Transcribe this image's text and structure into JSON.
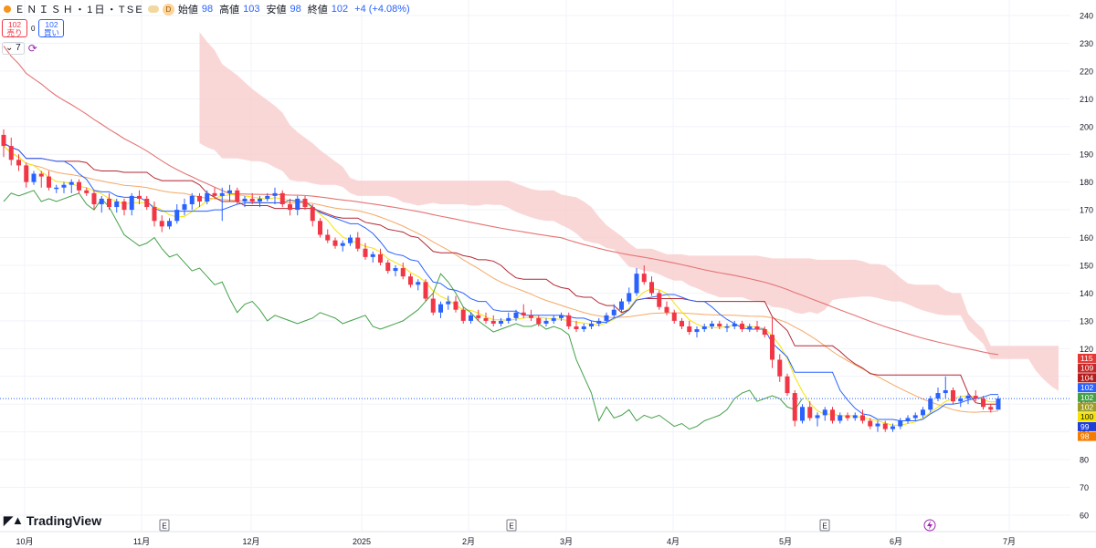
{
  "header": {
    "symbol": "ＥＮＩＳＨ・1日・TSE",
    "badge": "D",
    "open_label": "始値",
    "open_value": "98",
    "high_label": "高値",
    "high_value": "103",
    "low_label": "安値",
    "low_value": "98",
    "close_label": "終値",
    "close_value": "102",
    "change": "+4 (+4.08%)"
  },
  "trade": {
    "sell_price": "102",
    "sell_label": "売り",
    "spread": "0",
    "buy_price": "102",
    "buy_label": "買い"
  },
  "indicator": {
    "period": "7",
    "icon": "refresh-icon"
  },
  "logo": {
    "text": "TradingView",
    "icon": "tradingview-logo-icon"
  },
  "colors": {
    "up": "#2962ff",
    "down": "#f23645",
    "cloud": "#f8c9c9",
    "tenkan": "#2962ff",
    "kijun": "#b22833",
    "chikou": "#43a047",
    "ma_short": "#f5e400",
    "ma_mid": "#f5a865",
    "ma_long": "#e57373"
  },
  "chart_data": {
    "type": "candlestick",
    "y_axis": {
      "min": 60,
      "max": 240,
      "ticks": [
        60,
        70,
        80,
        90,
        100,
        110,
        120,
        130,
        140,
        150,
        160,
        170,
        180,
        190,
        200,
        210,
        220,
        230,
        240
      ]
    },
    "x_axis": {
      "labels": [
        "10月",
        "11月",
        "12月",
        "2025",
        "2月",
        "3月",
        "4月",
        "5月",
        "6月",
        "7月"
      ]
    },
    "earnings_markers": [
      "E",
      "E",
      "E"
    ],
    "price_scale_badges": [
      {
        "value": "115",
        "color": "#e53935"
      },
      {
        "value": "109",
        "color": "#c62828"
      },
      {
        "value": "104",
        "color": "#b71c1c"
      },
      {
        "value": "102",
        "color": "#2962ff"
      },
      {
        "value": "102",
        "color": "#43a047"
      },
      {
        "value": "102",
        "color": "#9e9d24"
      },
      {
        "value": "100",
        "color": "#f5e400"
      },
      {
        "value": "99",
        "color": "#1e3fd8"
      },
      {
        "value": "98",
        "color": "#f57c00"
      }
    ],
    "candles": [
      [
        197,
        199,
        189,
        193
      ],
      [
        193,
        196,
        186,
        188
      ],
      [
        188,
        190,
        184,
        186
      ],
      [
        186,
        187,
        178,
        180
      ],
      [
        180,
        184,
        179,
        183
      ],
      [
        183,
        184,
        178,
        182
      ],
      [
        182,
        184,
        177,
        178
      ],
      [
        178,
        179,
        176,
        178
      ],
      [
        178,
        180,
        176,
        179
      ],
      [
        179,
        181,
        176,
        180
      ],
      [
        180,
        181,
        176,
        177
      ],
      [
        177,
        178,
        175,
        176
      ],
      [
        176,
        177,
        170,
        172
      ],
      [
        172,
        175,
        169,
        174
      ],
      [
        174,
        176,
        170,
        171
      ],
      [
        171,
        174,
        169,
        173
      ],
      [
        173,
        174,
        168,
        170
      ],
      [
        170,
        176,
        168,
        175
      ],
      [
        175,
        177,
        172,
        174
      ],
      [
        174,
        175,
        170,
        171
      ],
      [
        171,
        173,
        164,
        166
      ],
      [
        166,
        168,
        162,
        164
      ],
      [
        164,
        167,
        163,
        166
      ],
      [
        166,
        172,
        165,
        170
      ],
      [
        170,
        174,
        168,
        172
      ],
      [
        172,
        176,
        170,
        175
      ],
      [
        175,
        176,
        171,
        173
      ],
      [
        173,
        177,
        172,
        176
      ],
      [
        176,
        178,
        174,
        175
      ],
      [
        175,
        178,
        166,
        176
      ],
      [
        176,
        179,
        173,
        177
      ],
      [
        177,
        178,
        172,
        173
      ],
      [
        173,
        175,
        171,
        174
      ],
      [
        174,
        176,
        172,
        173
      ],
      [
        173,
        175,
        171,
        174
      ],
      [
        174,
        176,
        173,
        175
      ],
      [
        175,
        178,
        172,
        176
      ],
      [
        176,
        177,
        171,
        172
      ],
      [
        172,
        174,
        168,
        170
      ],
      [
        170,
        175,
        168,
        174
      ],
      [
        174,
        175,
        170,
        171
      ],
      [
        171,
        172,
        164,
        166
      ],
      [
        166,
        167,
        160,
        161
      ],
      [
        161,
        163,
        158,
        159
      ],
      [
        159,
        160,
        156,
        157
      ],
      [
        157,
        159,
        155,
        158
      ],
      [
        158,
        161,
        157,
        160
      ],
      [
        160,
        162,
        155,
        156
      ],
      [
        156,
        158,
        152,
        153
      ],
      [
        153,
        155,
        151,
        154
      ],
      [
        154,
        156,
        150,
        151
      ],
      [
        151,
        152,
        147,
        148
      ],
      [
        148,
        150,
        146,
        149
      ],
      [
        149,
        151,
        145,
        146
      ],
      [
        146,
        147,
        142,
        143
      ],
      [
        143,
        145,
        141,
        144
      ],
      [
        144,
        145,
        137,
        138
      ],
      [
        138,
        140,
        132,
        133
      ],
      [
        133,
        137,
        131,
        136
      ],
      [
        136,
        139,
        134,
        137
      ],
      [
        137,
        139,
        133,
        134
      ],
      [
        134,
        135,
        129,
        130
      ],
      [
        130,
        133,
        129,
        132
      ],
      [
        132,
        134,
        130,
        131
      ],
      [
        131,
        133,
        129,
        130
      ],
      [
        130,
        132,
        128,
        129
      ],
      [
        129,
        131,
        128,
        130
      ],
      [
        130,
        133,
        129,
        131
      ],
      [
        131,
        134,
        130,
        133
      ],
      [
        133,
        136,
        131,
        132
      ],
      [
        132,
        134,
        130,
        131
      ],
      [
        131,
        132,
        128,
        129
      ],
      [
        129,
        131,
        128,
        130
      ],
      [
        130,
        132,
        129,
        131
      ],
      [
        131,
        133,
        130,
        132
      ],
      [
        132,
        133,
        127,
        128
      ],
      [
        128,
        130,
        126,
        127
      ],
      [
        127,
        129,
        126,
        128
      ],
      [
        128,
        130,
        127,
        129
      ],
      [
        129,
        131,
        128,
        130
      ],
      [
        130,
        133,
        129,
        132
      ],
      [
        132,
        136,
        131,
        134
      ],
      [
        134,
        138,
        133,
        137
      ],
      [
        137,
        142,
        136,
        140
      ],
      [
        140,
        149,
        139,
        147
      ],
      [
        147,
        150,
        143,
        144
      ],
      [
        144,
        146,
        139,
        140
      ],
      [
        140,
        141,
        134,
        135
      ],
      [
        135,
        137,
        132,
        133
      ],
      [
        133,
        134,
        129,
        130
      ],
      [
        130,
        131,
        127,
        128
      ],
      [
        128,
        130,
        125,
        126
      ],
      [
        126,
        128,
        124,
        127
      ],
      [
        127,
        129,
        126,
        128
      ],
      [
        128,
        130,
        127,
        129
      ],
      [
        129,
        130,
        127,
        128
      ],
      [
        128,
        129,
        126,
        128
      ],
      [
        128,
        130,
        127,
        129
      ],
      [
        129,
        130,
        126,
        127
      ],
      [
        127,
        129,
        126,
        128
      ],
      [
        128,
        130,
        126,
        127
      ],
      [
        127,
        128,
        124,
        125
      ],
      [
        125,
        131,
        113,
        116
      ],
      [
        116,
        118,
        108,
        110
      ],
      [
        110,
        111,
        103,
        104
      ],
      [
        104,
        105,
        92,
        94
      ],
      [
        94,
        100,
        93,
        99
      ],
      [
        99,
        101,
        94,
        95
      ],
      [
        95,
        97,
        92,
        96
      ],
      [
        96,
        99,
        94,
        98
      ],
      [
        98,
        99,
        93,
        94
      ],
      [
        94,
        97,
        93,
        96
      ],
      [
        96,
        97,
        94,
        95
      ],
      [
        95,
        97,
        94,
        96
      ],
      [
        96,
        98,
        93,
        94
      ],
      [
        94,
        95,
        91,
        92
      ],
      [
        92,
        94,
        90,
        93
      ],
      [
        93,
        94,
        90,
        91
      ],
      [
        91,
        93,
        90,
        92
      ],
      [
        92,
        95,
        91,
        94
      ],
      [
        94,
        96,
        93,
        95
      ],
      [
        95,
        97,
        94,
        96
      ],
      [
        96,
        99,
        95,
        98
      ],
      [
        98,
        103,
        97,
        102
      ],
      [
        102,
        106,
        101,
        104
      ],
      [
        104,
        110,
        102,
        105
      ],
      [
        105,
        106,
        100,
        101
      ],
      [
        101,
        103,
        99,
        102
      ],
      [
        102,
        104,
        100,
        103
      ],
      [
        103,
        105,
        101,
        102
      ],
      [
        102,
        103,
        98,
        99
      ],
      [
        99,
        100,
        97,
        98
      ],
      [
        98,
        103,
        98,
        102
      ]
    ]
  }
}
